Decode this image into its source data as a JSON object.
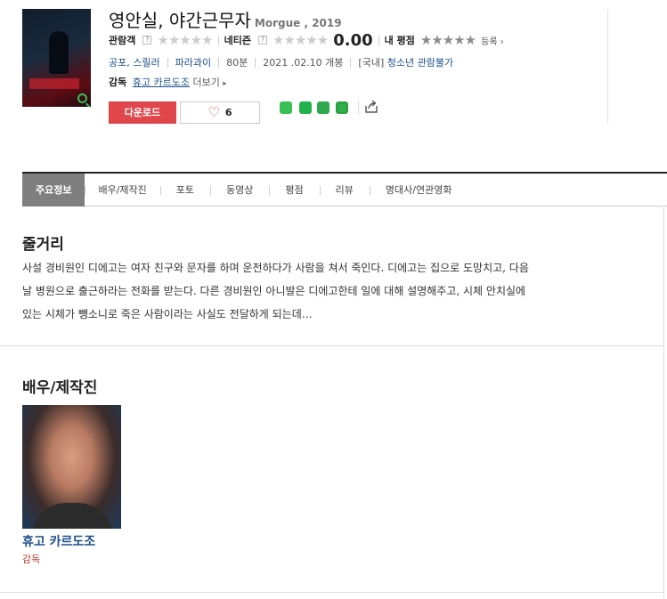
{
  "movie": {
    "title": "영안실, 야간근무자",
    "subtitle": "Morgue , 2019",
    "audience_label": "관람객",
    "netizen_label": "네티즌",
    "netizen_score": "0.00",
    "my_rating_label": "내 평점",
    "register_label": "등록",
    "genre": "공포, 스릴러",
    "country": "파라과이",
    "runtime": "80분",
    "release": "2021 .02.10 개봉",
    "rating_prefix": "[국내]",
    "rating": "청소년 관람불가",
    "director_label": "감독",
    "director": "휴고 카르도조",
    "more_label": "더보기"
  },
  "actions": {
    "download_label": "다운로드",
    "like_count": "6"
  },
  "tabs": [
    "주요정보",
    "배우/제작진",
    "포토",
    "동영상",
    "평점",
    "리뷰",
    "명대사/연관영화"
  ],
  "synopsis": {
    "heading": "줄거리",
    "line1": "사설 경비원인 디에고는 여자 친구와 문자를 하며 운전하다가 사람을 쳐서 죽인다. 디에고는 집으로 도망치고, 다음",
    "line2": "날 병원으로 출근하라는 전화를 받는다. 다른 경비원인 아니발은 디에고한테 일에 대해 설명해주고, 시체 안치실에",
    "line3": "있는 시체가 뺑소니로 죽은 사람이라는 사실도 전달하게 되는데…"
  },
  "cast": {
    "heading": "배우/제작진",
    "person_name": "휴고 카르도조",
    "person_role": "감독"
  }
}
